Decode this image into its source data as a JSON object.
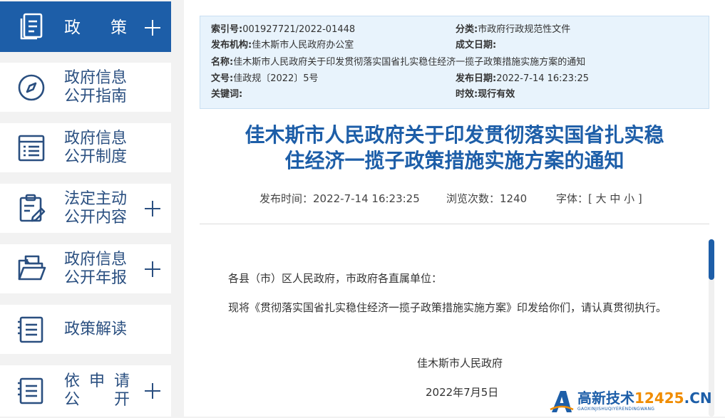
{
  "sidebar": {
    "items": [
      {
        "label_chars": [
          "政",
          "策"
        ],
        "icon": "document-stack-icon",
        "has_plus": true,
        "active": true
      },
      {
        "label_lines": [
          "政府信息",
          "公开指南"
        ],
        "icon": "compass-icon",
        "has_plus": false
      },
      {
        "label_lines": [
          "政府信息",
          "公开制度"
        ],
        "icon": "list-document-icon",
        "has_plus": false
      },
      {
        "label_lines": [
          "法定主动",
          "公开内容"
        ],
        "icon": "clipboard-edit-icon",
        "has_plus": true
      },
      {
        "label_lines": [
          "政府信息",
          "公开年报"
        ],
        "icon": "folder-icon",
        "has_plus": true
      },
      {
        "label_lines": [
          "政策解读"
        ],
        "icon": "notes-icon",
        "has_plus": false
      },
      {
        "label_grid": [
          [
            "依",
            "申",
            "请"
          ],
          [
            "公",
            "",
            "开"
          ]
        ],
        "icon": "notes-icon",
        "has_plus": true
      }
    ]
  },
  "meta": {
    "index_key": "索引号:",
    "index_value": "001927721/2022-01448",
    "category_key": "分类:",
    "category_value": "市政府行政规范性文件",
    "publisher_key": "发布机构:",
    "publisher_value": "佳木斯市人民政府办公室",
    "created_key": "成文日期:",
    "created_value": "",
    "name_key": "名称:",
    "name_value": "佳木斯市人民政府关于印发贯彻落实国省扎实稳住经济一揽子政策措施实施方案的通知",
    "docno_key": "文号:",
    "docno_value": "佳政规〔2022〕5号",
    "pubdate_key": "发布日期:",
    "pubdate_value": "2022-7-14 16:23:25",
    "keywords_key": "关键词:",
    "keywords_value": "",
    "validity_key": "时效:",
    "validity_value": "现行有效"
  },
  "article": {
    "title_line1": "佳木斯市人民政府关于印发贯彻落实国省扎实稳",
    "title_line2": "住经济一揽子政策措施实施方案的通知",
    "publish_time": "发布时间：2022-7-14 16:23:25",
    "views": "浏览次数：1240",
    "font_label": "字体：[ 大 中 小 ]",
    "salutation": "各县（市）区人民政府，市政府各直属单位：",
    "paragraph": "现将《贯彻落实国省扎实稳住经济一揽子政策措施实施方案》印发给你们，请认真贯彻执行。",
    "signature": "佳木斯市人民政府",
    "date": "2022年7月5日"
  },
  "watermark": {
    "text_main": "高新技术",
    "text_accent": "12425",
    "text_suffix": ".CN",
    "subtext": "GAOXINJISHUQIYERENDINGWANG"
  },
  "colors": {
    "accent": "#1d5ea8",
    "sidebar_text": "#2a4f80",
    "meta_bg": "#e8f3fc",
    "watermark_accent": "#f08c00"
  },
  "scroll": {
    "thumb_fraction": 0.23
  }
}
